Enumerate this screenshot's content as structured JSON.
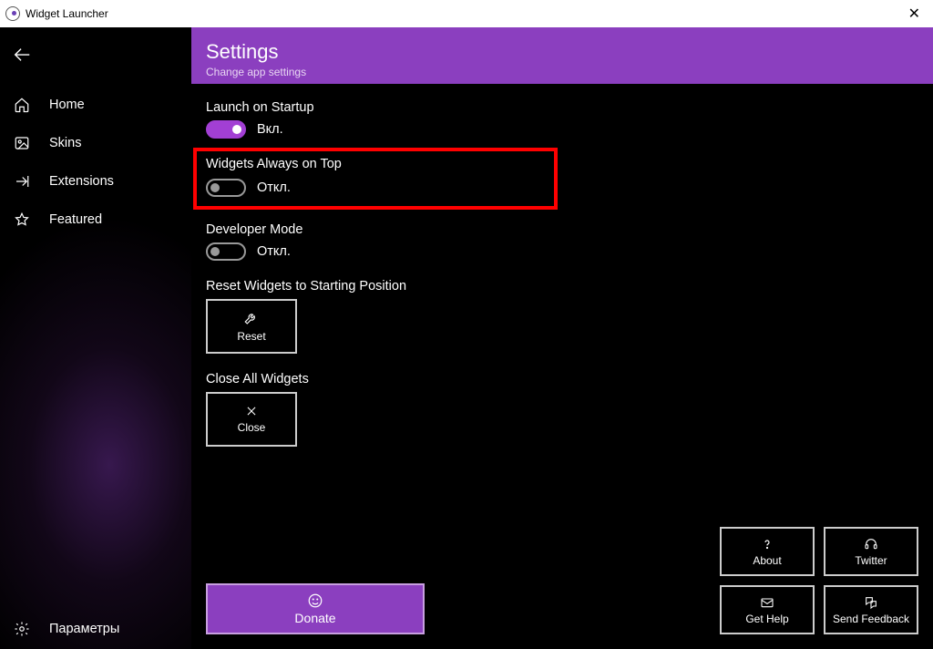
{
  "window": {
    "title": "Widget Launcher"
  },
  "sidebar": {
    "items": [
      {
        "label": "Home"
      },
      {
        "label": "Skins"
      },
      {
        "label": "Extensions"
      },
      {
        "label": "Featured"
      }
    ],
    "bottom_label": "Параметры"
  },
  "header": {
    "title": "Settings",
    "subtitle": "Change app settings"
  },
  "settings": {
    "launch_on_startup": {
      "label": "Launch on Startup",
      "state_text": "Вкл.",
      "on": true
    },
    "always_on_top": {
      "label": "Widgets Always on Top",
      "state_text": "Откл.",
      "on": false,
      "highlighted": true
    },
    "developer_mode": {
      "label": "Developer Mode",
      "state_text": "Откл.",
      "on": false
    },
    "reset": {
      "label": "Reset Widgets to Starting Position",
      "button": "Reset"
    },
    "close_all": {
      "label": "Close All Widgets",
      "button": "Close"
    }
  },
  "footer": {
    "donate": "Donate",
    "about": "About",
    "twitter": "Twitter",
    "get_help": "Get Help",
    "send_feedback": "Send Feedback"
  }
}
